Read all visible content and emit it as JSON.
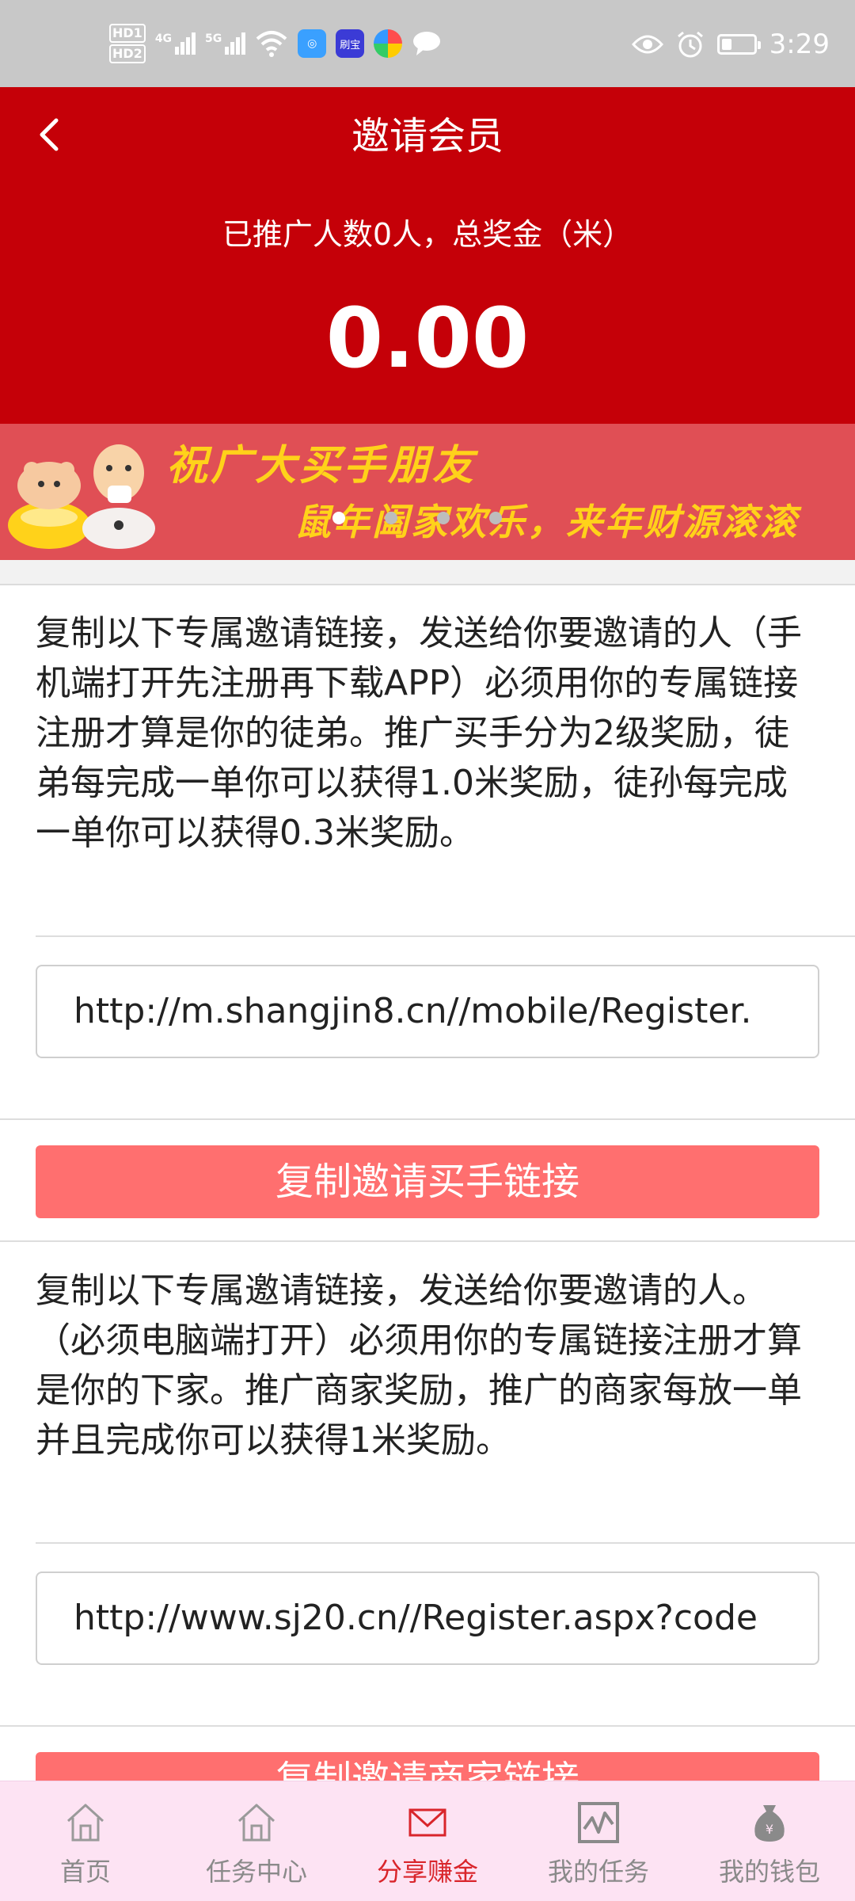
{
  "status_bar": {
    "hd1": "HD1",
    "hd2": "HD2",
    "net1": "4G",
    "net2": "5G",
    "app_badge": "刷宝",
    "time": "3:29"
  },
  "header": {
    "title": "邀请会员",
    "summary": "已推广人数0人，总奖金（米）",
    "total": "0.00"
  },
  "banner": {
    "line1": "祝广大买手朋友",
    "line2": "鼠年阖家欢乐，来年财源滚滚"
  },
  "buyer_invite": {
    "description": "复制以下专属邀请链接，发送给你要邀请的人（手机端打开先注册再下载APP）必须用你的专属链接注册才算是你的徒弟。推广买手分为2级奖励，徒弟每完成一单你可以获得1.0米奖励，徒孙每完成一单你可以获得0.3米奖励。",
    "link": "http://m.shangjin8.cn//mobile/Register.",
    "button_label": "复制邀请买手链接"
  },
  "merchant_invite": {
    "description": "复制以下专属邀请链接，发送给你要邀请的人。（必须电脑端打开）必须用你的专属链接注册才算是你的下家。推广商家奖励，推广的商家每放一单并且完成你可以获得1米奖励。",
    "link": "http://www.sj20.cn//Register.aspx?code",
    "button_label": "复制邀请商家链接"
  },
  "bottom_nav": {
    "items": [
      {
        "label": "首页",
        "icon": "home-icon"
      },
      {
        "label": "任务中心",
        "icon": "home-icon"
      },
      {
        "label": "分享赚金",
        "icon": "mail-icon"
      },
      {
        "label": "我的任务",
        "icon": "chart-icon"
      },
      {
        "label": "我的钱包",
        "icon": "money-bag-icon"
      }
    ],
    "active_index": 2
  },
  "colors": {
    "header_red": "#c50008",
    "banner_red": "#e04f55",
    "banner_text": "#ffd21a",
    "button_pink": "#ff6f6f",
    "nav_bg": "#fde3f3",
    "nav_active": "#d9252b"
  }
}
